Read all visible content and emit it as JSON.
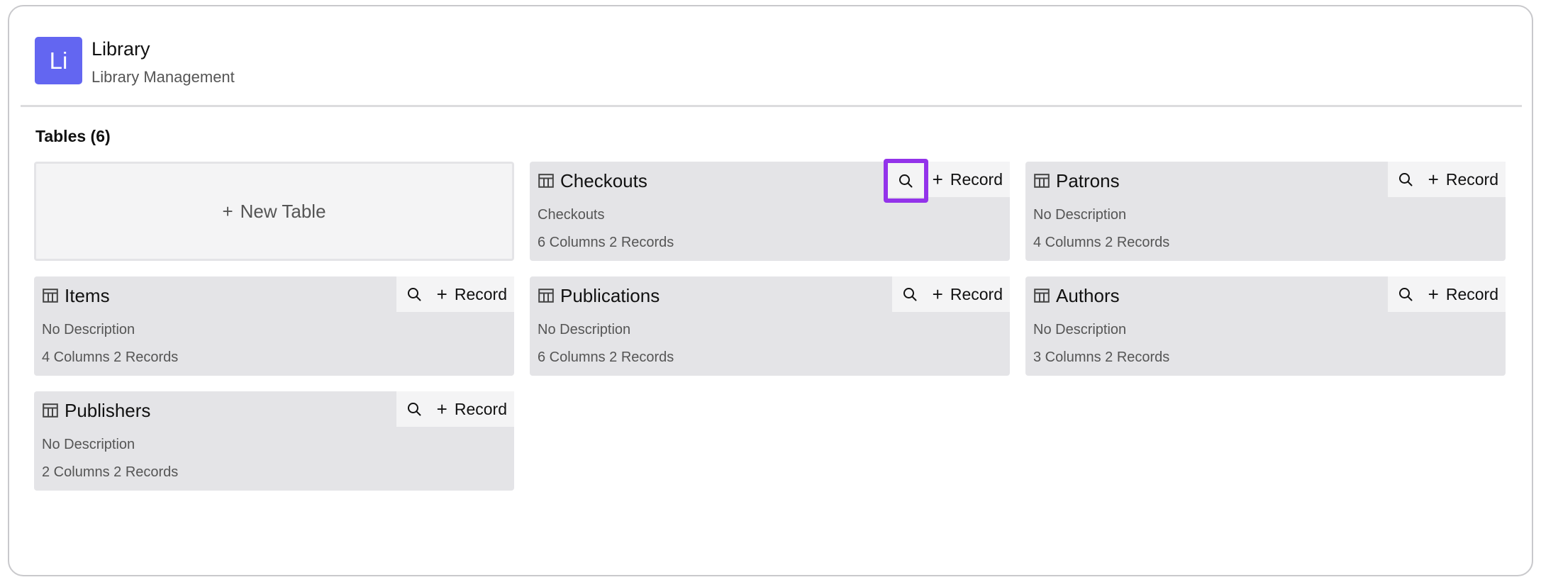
{
  "app": {
    "logo_text": "Li",
    "title": "Library",
    "subtitle": "Library Management",
    "accent_color": "#6366f1"
  },
  "tables_heading": "Tables (6)",
  "new_table_label": "New Table",
  "action_labels": {
    "record": "Record"
  },
  "highlight_color": "#9333ea",
  "tables": [
    {
      "name": "Checkouts",
      "description": "Checkouts",
      "meta": "6 Columns 2 Records"
    },
    {
      "name": "Patrons",
      "description": "No Description",
      "meta": "4 Columns 2 Records"
    },
    {
      "name": "Items",
      "description": "No Description",
      "meta": "4 Columns 2 Records"
    },
    {
      "name": "Publications",
      "description": "No Description",
      "meta": "6 Columns 2 Records"
    },
    {
      "name": "Authors",
      "description": "No Description",
      "meta": "3 Columns 2 Records"
    },
    {
      "name": "Publishers",
      "description": "No Description",
      "meta": "2 Columns 2 Records"
    }
  ]
}
